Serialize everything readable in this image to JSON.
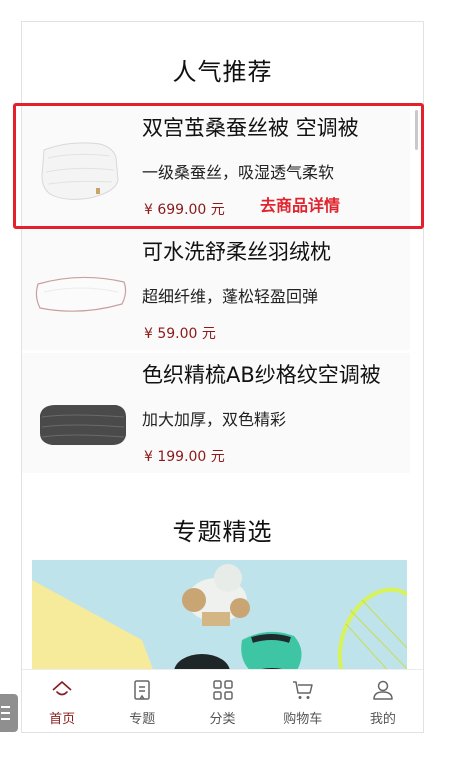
{
  "recommend": {
    "title": "人气推荐",
    "detail_link": "去商品详情",
    "products": [
      {
        "name": "双宫茧桑蚕丝被 空调被",
        "desc": "一级桑蚕丝，吸湿透气柔软",
        "price": "¥ 699.00 元",
        "image": "quilt-image"
      },
      {
        "name": "可水洗舒柔丝羽绒枕",
        "desc": "超细纤维，蓬松轻盈回弹",
        "price": "¥ 59.00 元",
        "image": "pillow-image"
      },
      {
        "name": "色织精梳AB纱格纹空调被",
        "desc": "加大加厚，双色精彩",
        "price": "¥ 199.00 元",
        "image": "folded-blanket-image"
      }
    ]
  },
  "topics": {
    "title": "专题精选",
    "banner_image": "toy-banner-image"
  },
  "tabbar": {
    "items": [
      {
        "label": "首页",
        "icon": "home-icon",
        "active": true
      },
      {
        "label": "专题",
        "icon": "topic-icon",
        "active": false
      },
      {
        "label": "分类",
        "icon": "category-icon",
        "active": false
      },
      {
        "label": "购物车",
        "icon": "cart-icon",
        "active": false
      },
      {
        "label": "我的",
        "icon": "user-icon",
        "active": false
      }
    ]
  },
  "colors": {
    "accent": "#8b1a1a",
    "highlight": "#e5202c"
  }
}
